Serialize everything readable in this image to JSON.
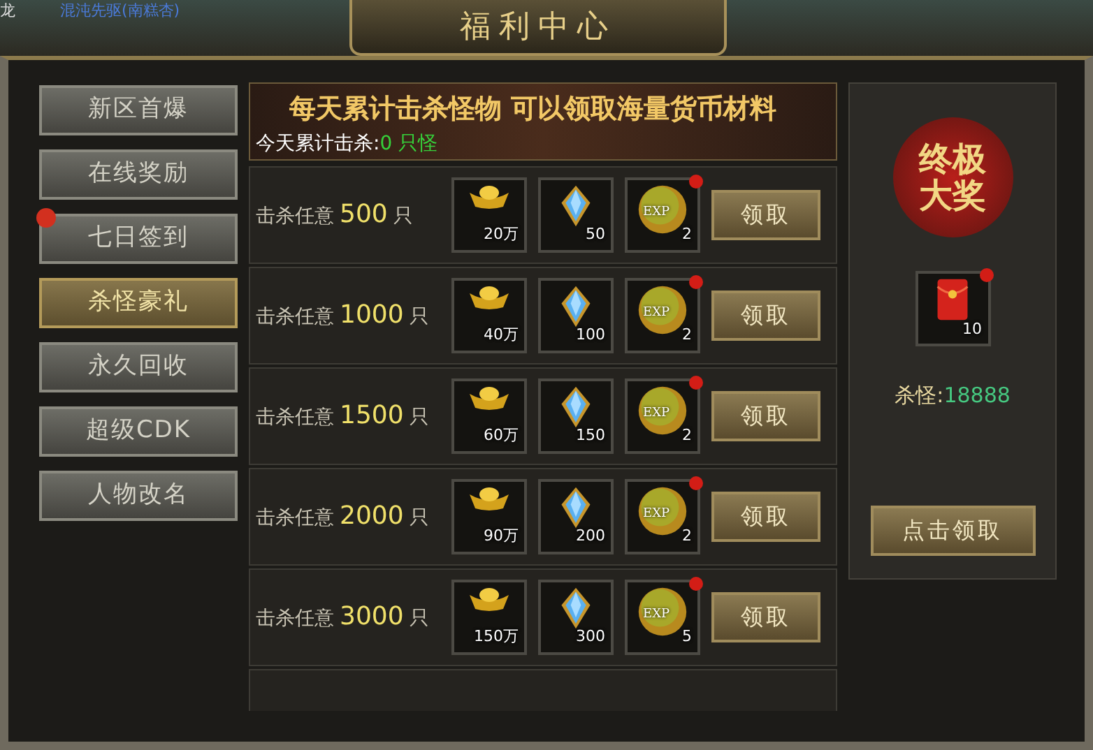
{
  "background_text": [
    "龙",
    "混沌先驱(南糕杏)"
  ],
  "window": {
    "title": "福利中心"
  },
  "sidebar": {
    "items": [
      {
        "label": "新区首爆",
        "selected": false,
        "alert": false
      },
      {
        "label": "在线奖励",
        "selected": false,
        "alert": false
      },
      {
        "label": "七日签到",
        "selected": false,
        "alert": true
      },
      {
        "label": "杀怪豪礼",
        "selected": true,
        "alert": false
      },
      {
        "label": "永久回收",
        "selected": false,
        "alert": false
      },
      {
        "label": "超级CDK",
        "selected": false,
        "alert": false
      },
      {
        "label": "人物改名",
        "selected": false,
        "alert": false
      }
    ]
  },
  "banner": {
    "headline": "每天累计击杀怪物  可以领取海量货币材料",
    "progress_label": "今天累计击杀:",
    "progress_value": "0 只怪"
  },
  "rows": [
    {
      "prefix": "击杀任意",
      "count": "500",
      "unit": "只",
      "items": [
        {
          "kind": "ingot",
          "amount": "20万",
          "dot": false
        },
        {
          "kind": "crystal",
          "amount": "50",
          "dot": false
        },
        {
          "kind": "exp",
          "label": "EXP",
          "amount": "2",
          "dot": true
        }
      ],
      "button": "领取"
    },
    {
      "prefix": "击杀任意",
      "count": "1000",
      "unit": "只",
      "items": [
        {
          "kind": "ingot",
          "amount": "40万",
          "dot": false
        },
        {
          "kind": "crystal",
          "amount": "100",
          "dot": false
        },
        {
          "kind": "exp",
          "label": "EXP",
          "amount": "2",
          "dot": true
        }
      ],
      "button": "领取"
    },
    {
      "prefix": "击杀任意",
      "count": "1500",
      "unit": "只",
      "items": [
        {
          "kind": "ingot",
          "amount": "60万",
          "dot": false
        },
        {
          "kind": "crystal",
          "amount": "150",
          "dot": false
        },
        {
          "kind": "exp",
          "label": "EXP",
          "amount": "2",
          "dot": true
        }
      ],
      "button": "领取"
    },
    {
      "prefix": "击杀任意",
      "count": "2000",
      "unit": "只",
      "items": [
        {
          "kind": "ingot",
          "amount": "90万",
          "dot": false
        },
        {
          "kind": "crystal",
          "amount": "200",
          "dot": false
        },
        {
          "kind": "exp",
          "label": "EXP",
          "amount": "2",
          "dot": true
        }
      ],
      "button": "领取"
    },
    {
      "prefix": "击杀任意",
      "count": "3000",
      "unit": "只",
      "items": [
        {
          "kind": "ingot",
          "amount": "150万",
          "dot": false
        },
        {
          "kind": "crystal",
          "amount": "300",
          "dot": false
        },
        {
          "kind": "exp",
          "label": "EXP",
          "amount": "5",
          "dot": true
        }
      ],
      "button": "领取"
    }
  ],
  "grand_prize": {
    "title_lines": [
      "终极",
      "大奖"
    ],
    "reward": {
      "kind": "envelope",
      "amount": "10",
      "dot": true
    },
    "kills_label": "杀怪:",
    "kills_value": "18888",
    "button": "点击领取"
  }
}
